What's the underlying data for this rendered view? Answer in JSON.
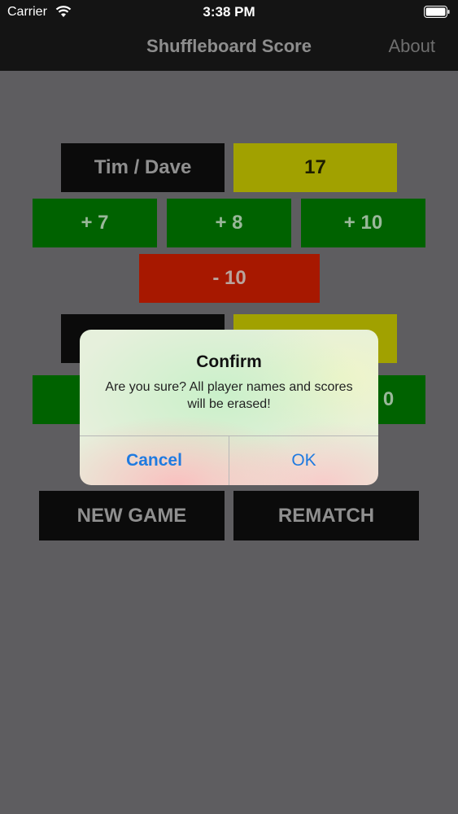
{
  "status_bar": {
    "carrier": "Carrier",
    "time": "3:38 PM"
  },
  "nav": {
    "title": "Shuffleboard Score",
    "about": "About"
  },
  "team1": {
    "name": "Tim / Dave",
    "score": "17",
    "buttons": {
      "plus7": "+ 7",
      "plus8": "+ 8",
      "plus10": "+ 10",
      "minus10": "- 10"
    }
  },
  "team2": {
    "plus10_partial": "0"
  },
  "actions": {
    "new_game": "NEW GAME",
    "rematch": "REMATCH"
  },
  "dialog": {
    "title": "Confirm",
    "message": "Are you sure? All player names and scores will be erased!",
    "cancel": "Cancel",
    "ok": "OK"
  },
  "colors": {
    "background": "#5e5d60",
    "bar": "#141414",
    "name_tile": "#0b0b0b",
    "score_tile": "#a1a100",
    "plus_tile": "#006200",
    "minus_tile": "#a71800",
    "dialog_button": "#1f7ae0"
  },
  "icons": {
    "wifi": "wifi-icon",
    "battery": "battery-icon"
  }
}
